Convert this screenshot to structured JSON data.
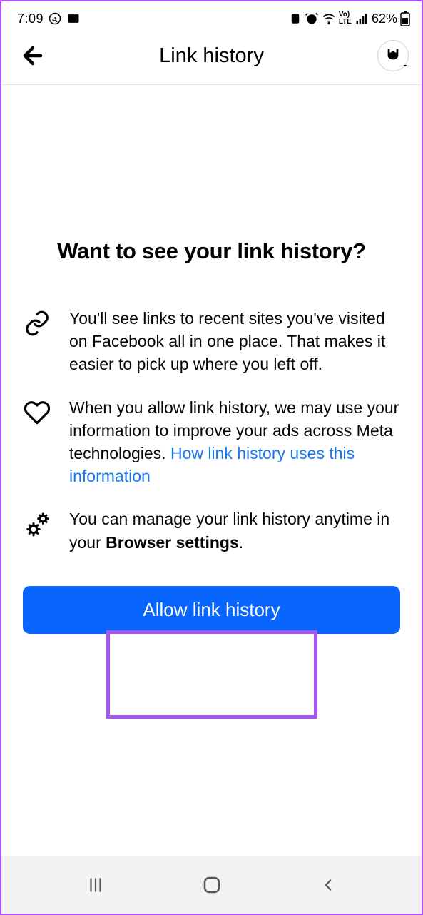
{
  "status": {
    "time": "7:09",
    "battery_pct": "62%"
  },
  "header": {
    "title": "Link history"
  },
  "content": {
    "heading": "Want to see your link history?",
    "items": [
      {
        "text": "You'll see links to recent sites you've visited on Facebook all in one place. That makes it easier to pick up where you left off."
      },
      {
        "text": "When you allow link history, we may use your information to improve your ads across Meta technologies. ",
        "link": "How link history uses this information"
      },
      {
        "text_pre": "You can manage your link history anytime in your ",
        "bold": "Browser settings",
        "text_post": "."
      }
    ],
    "button_label": "Allow link history"
  }
}
